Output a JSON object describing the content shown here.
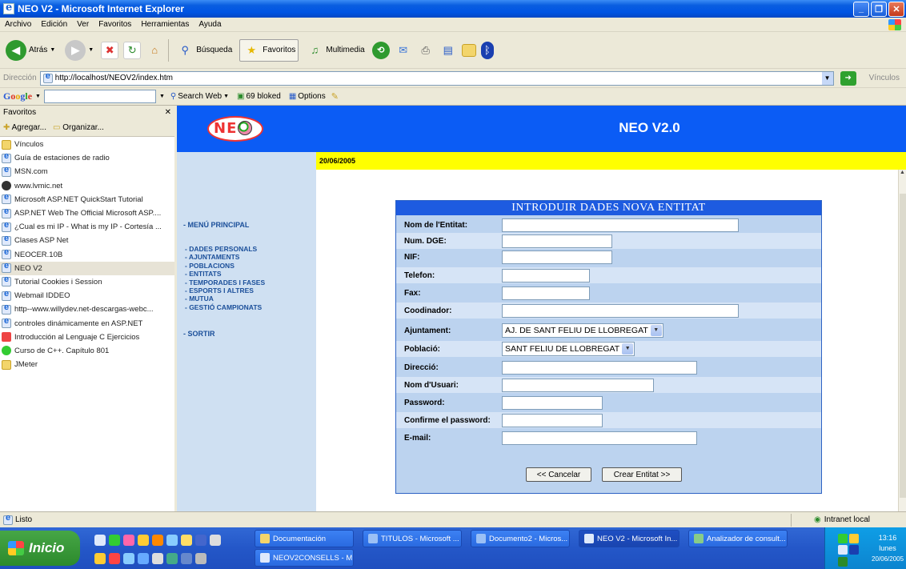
{
  "window": {
    "title": "NEO V2 - Microsoft Internet Explorer"
  },
  "menu": {
    "items": [
      "Archivo",
      "Edición",
      "Ver",
      "Favoritos",
      "Herramientas",
      "Ayuda"
    ]
  },
  "toolbar": {
    "back": "Atrás",
    "search": "Búsqueda",
    "favorites": "Favoritos",
    "multimedia": "Multimedia"
  },
  "address": {
    "label": "Dirección",
    "url": "http://localhost/NEOV2/index.htm",
    "links": "Vínculos"
  },
  "google": {
    "search_web": "Search Web",
    "blocked": "69 bloked",
    "options": "Options"
  },
  "favorites": {
    "title": "Favoritos",
    "add": "Agregar...",
    "organize": "Organizar...",
    "items": [
      "Vínculos",
      "Guía de estaciones de radio",
      "MSN.com",
      "www.lvmic.net",
      "Microsoft ASP.NET QuickStart Tutorial",
      "ASP.NET Web The Official Microsoft ASP....",
      "¿Cual es mi IP - What is my IP - Cortesía ...",
      "Clases ASP Net",
      "NEOCER.10B",
      "NEO V2",
      "Tutorial Cookies i Session",
      "Webmail IDDEO",
      "http--www.willydev.net-descargas-webc...",
      "controles dinámicamente en ASP.NET",
      "Introducción al Lenguaje C Ejercicios",
      "Curso de C++. Capítulo 801",
      "JMeter"
    ],
    "selected_index": 9
  },
  "page": {
    "title": "NEO V2.0",
    "logo_text": "NEO",
    "date": "20/06/2005",
    "nav": {
      "main": "- MENÚ PRINCIPAL",
      "links": [
        "- DADES PERSONALS",
        "- AJUNTAMENTS",
        "- POBLACIONS",
        "- ENTITATS",
        "- TEMPORADES I FASES",
        "- ESPORTS I ALTRES",
        "- MUTUA",
        "- GESTIÓ CAMPIONATS"
      ],
      "exit": "- SORTIR"
    }
  },
  "form": {
    "title": "INTRODUIR DADES NOVA ENTITAT",
    "fields": {
      "nom": "Nom de l'Entitat:",
      "dge": "Num. DGE:",
      "nif": "NIF:",
      "telefon": "Telefon:",
      "fax": "Fax:",
      "coord": "Coodinador:",
      "ajuntament": "Ajuntament:",
      "poblacio": "Població:",
      "direccio": "Direcció:",
      "usuari": "Nom d'Usuari:",
      "password": "Password:",
      "confirm": "Confirme el password:",
      "email": "E-mail:"
    },
    "ajuntament_value": "AJ. DE SANT FELIU DE LLOBREGAT",
    "poblacio_value": "SANT FELIU DE LLOBREGAT",
    "cancel": "<< Cancelar",
    "create": "Crear Entitat >>"
  },
  "status": {
    "left": "Listo",
    "zone": "Intranet local"
  },
  "taskbar": {
    "start": "Inicio",
    "tasks": [
      "Documentación",
      "NEOV2CONSELLS - M...",
      "TITULOS - Microsoft ...",
      "Documento2 - Micros...",
      "NEO V2 - Microsoft In...",
      "Analizador de consult..."
    ],
    "clock": {
      "time": "13:16",
      "day": "lunes",
      "date": "20/06/2005"
    }
  }
}
